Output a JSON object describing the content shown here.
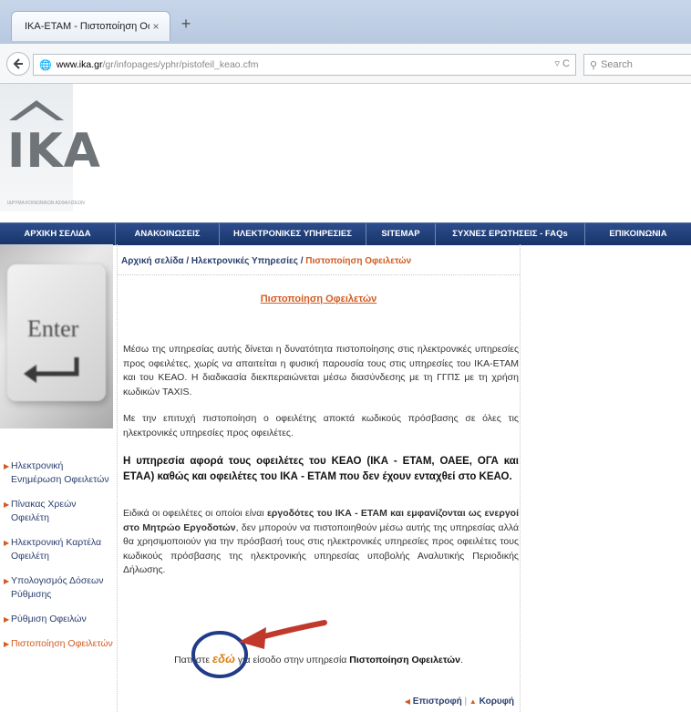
{
  "browser": {
    "tab_title": "ΙΚΑ-ΕΤΑΜ - Πιστοποίηση Οφε...",
    "tab_close": "×",
    "new_tab": "+",
    "url_host": "www.ika.gr",
    "url_path": "/gr/infopages/yphr/pistofeil_keao.cfm",
    "url_tools": "▿ C",
    "search_placeholder": "Search"
  },
  "header": {
    "logo_text": "ΙΚΑ",
    "logo_sub": "ΙΔΡΥΜΑ ΚΟΙΝΩΝΙΚΩΝ ΑΣΦΑΛΙΣΕΩΝ"
  },
  "menu": [
    "ΑΡΧΙΚΗ ΣΕΛΙΔΑ",
    "ΑΝΑΚΟΙΝΩΣΕΙΣ",
    "ΗΛΕΚΤΡΟΝΙΚΕΣ ΥΠΗΡΕΣΙΕΣ",
    "SITEMAP",
    "ΣΥΧΝΕΣ ΕΡΩΤΗΣΕΙΣ - FAQs",
    "ΕΠΙΚΟΙΝΩΝΙΑ"
  ],
  "side_image": {
    "key_label": "Enter"
  },
  "leftnav": [
    "Ηλεκτρονική Ενημέρωση Οφειλετών",
    "Πίνακας Χρεών Οφειλέτη",
    "Ηλεκτρονική Καρτέλα Οφειλέτη",
    "Υπολογισμός Δόσεων Ρύθμισης",
    "Ρύθμιση Οφειλών",
    "Πιστοποίηση Οφειλετών"
  ],
  "breadcrumb": {
    "home": "Αρχική σελίδα",
    "sep1": " / ",
    "services": "Ηλεκτρονικές Υπηρεσίες",
    "sep2": " / ",
    "current": "Πιστοποίηση Οφειλετών"
  },
  "content": {
    "title": "Πιστοποίηση Οφειλετών",
    "p1": "Μέσω της υπηρεσίας αυτής δίνεται η δυνατότητα πιστοποίησης στις ηλεκτρονικές υπηρεσίες προς οφειλέτες, χωρίς να απαιτείται η φυσική παρουσία τους στις υπηρεσίες του ΙΚΑ-ΕΤΑΜ και του ΚΕΑΟ. Η διαδικασία διεκπεραιώνεται μέσω διασύνδεσης με τη ΓΓΠΣ με τη χρήση κωδικών TAXIS.",
    "p2": "Με την επιτυχή πιστοποίηση ο οφειλέτης αποκτά κωδικούς πρόσβασης σε όλες τις ηλεκτρονικές υπηρεσίες προς οφειλέτες.",
    "p3": "Η υπηρεσία αφορά τους οφειλέτες του ΚΕΑΟ (ΙΚΑ - ΕΤΑΜ, ΟΑΕΕ, ΟΓΑ και ΕΤΑΑ) καθώς και οφειλέτες του ΙΚΑ - ΕΤΑΜ που δεν έχουν ενταχθεί στο ΚΕΑΟ.",
    "p4_a": "Ειδικά οι οφειλέτες οι οποίοι είναι ",
    "p4_b": "εργοδότες του ΙΚΑ - ΕΤΑΜ και εμφανίζονται ως ενεργοί στο Μητρώο Εργοδοτών",
    "p4_c": ", δεν μπορούν να πιστοποιηθούν μέσω αυτής της υπηρεσίας αλλά θα χρησιμοποιούν για την πρόσβασή τους στις ηλεκτρονικές υπηρεσίες προς οφειλέτες τους κωδικούς πρόσβασης της ηλεκτρονικής υπηρεσίας υποβολής Αναλυτικής Περιοδικής Δήλωσης.",
    "cta_pre": "Πατήστε ",
    "cta_link": "εδώ",
    "cta_mid": " για είσοδο στην υπηρεσία ",
    "cta_bold": "Πιστοποίηση Οφειλετών",
    "cta_end": "."
  },
  "footer": {
    "back": "Επιστροφή",
    "sep": " | ",
    "top": "Κορυφή"
  },
  "colors": {
    "menu_bg": "#173469",
    "accent_orange": "#d35b1f",
    "link_blue": "#2a3f6e",
    "annotation_circle": "#1f3b8a",
    "annotation_arrow": "#c0392b"
  }
}
